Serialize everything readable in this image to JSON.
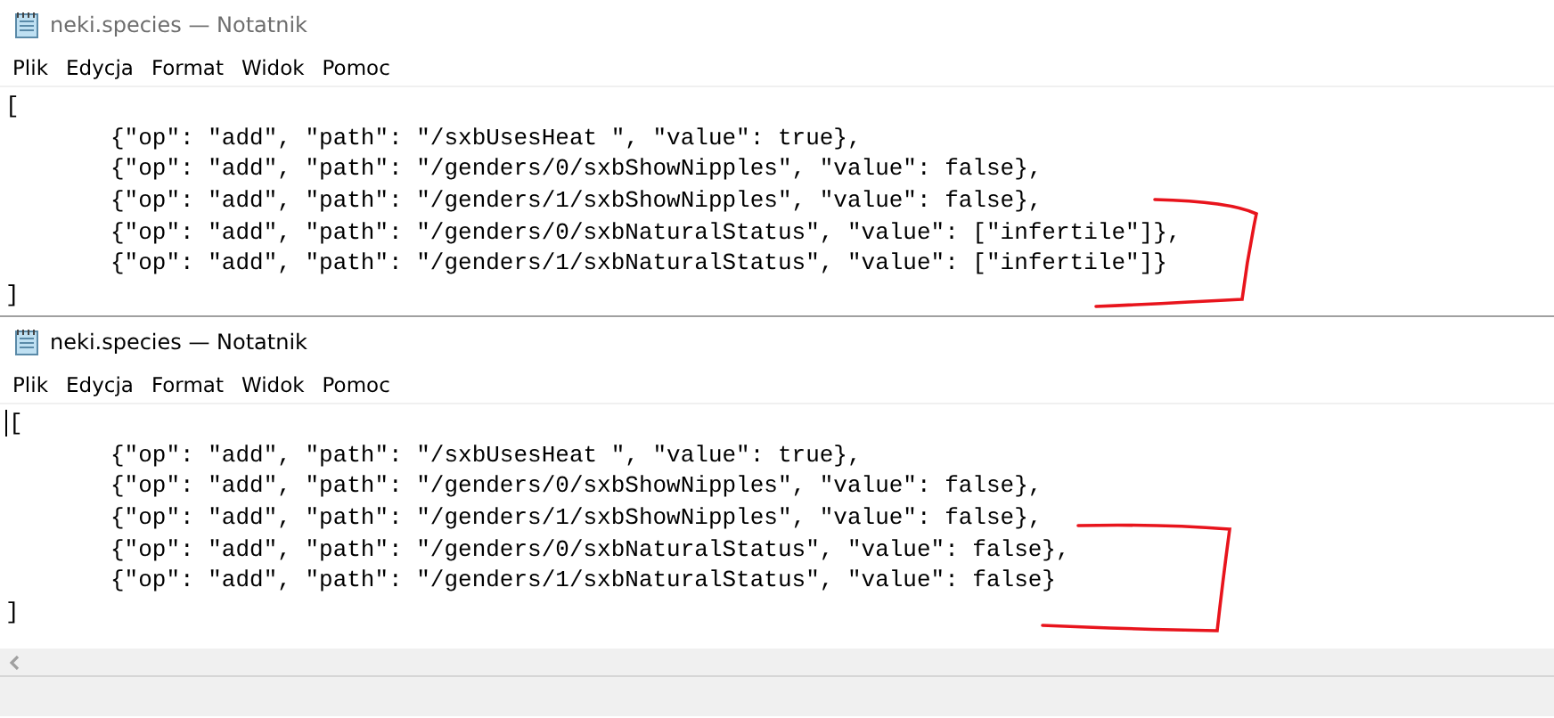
{
  "windows": [
    {
      "title": "neki.species — Notatnik",
      "active": false,
      "caret": false,
      "scrollbar": false,
      "annotated": true,
      "menu": [
        "Plik",
        "Edycja",
        "Format",
        "Widok",
        "Pomoc"
      ],
      "lines": [
        {
          "kind": "bracket",
          "text": "["
        },
        {
          "kind": "entry",
          "text": "{\"op\": \"add\", \"path\": \"/sxbUsesHeat \", \"value\": true},"
        },
        {
          "kind": "entry",
          "text": "{\"op\": \"add\", \"path\": \"/genders/0/sxbShowNipples\", \"value\": false},"
        },
        {
          "kind": "entry",
          "text": "{\"op\": \"add\", \"path\": \"/genders/1/sxbShowNipples\", \"value\": false},"
        },
        {
          "kind": "entry",
          "text": "{\"op\": \"add\", \"path\": \"/genders/0/sxbNaturalStatus\", \"value\": [\"infertile\"]},"
        },
        {
          "kind": "entry",
          "text": "{\"op\": \"add\", \"path\": \"/genders/1/sxbNaturalStatus\", \"value\": [\"infertile\"]}"
        },
        {
          "kind": "bracket",
          "text": "]"
        }
      ]
    },
    {
      "title": "neki.species — Notatnik",
      "active": true,
      "caret": true,
      "scrollbar": true,
      "annotated": true,
      "menu": [
        "Plik",
        "Edycja",
        "Format",
        "Widok",
        "Pomoc"
      ],
      "lines": [
        {
          "kind": "bracket",
          "text": "["
        },
        {
          "kind": "entry",
          "text": "{\"op\": \"add\", \"path\": \"/sxbUsesHeat \", \"value\": true},"
        },
        {
          "kind": "entry",
          "text": "{\"op\": \"add\", \"path\": \"/genders/0/sxbShowNipples\", \"value\": false},"
        },
        {
          "kind": "entry",
          "text": "{\"op\": \"add\", \"path\": \"/genders/1/sxbShowNipples\", \"value\": false},"
        },
        {
          "kind": "entry",
          "text": "{\"op\": \"add\", \"path\": \"/genders/0/sxbNaturalStatus\", \"value\": false},"
        },
        {
          "kind": "entry",
          "text": "{\"op\": \"add\", \"path\": \"/genders/1/sxbNaturalStatus\", \"value\": false}"
        },
        {
          "kind": "bracket",
          "text": "]"
        }
      ]
    }
  ]
}
